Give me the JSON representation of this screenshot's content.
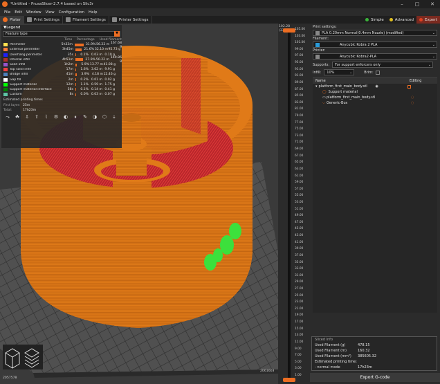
{
  "window": {
    "title": "*Untitled - PrusaSlicer-2.7.4 based on Slic3r"
  },
  "menu": [
    "File",
    "Edit",
    "Window",
    "View",
    "Configuration",
    "Help"
  ],
  "tabs": [
    {
      "label": "Plater",
      "active": true
    },
    {
      "label": "Print Settings",
      "active": false
    },
    {
      "label": "Filament Settings",
      "active": false
    },
    {
      "label": "Printer Settings",
      "active": false
    }
  ],
  "modes": [
    {
      "label": "Simple",
      "color": "#3bb43b"
    },
    {
      "label": "Advanced",
      "color": "#e0c020"
    },
    {
      "label": "Expert",
      "color": "#e04020"
    }
  ],
  "legend": {
    "title": "Legend",
    "view_type": "Feature type",
    "columns": [
      "",
      "Time",
      "Percentage",
      "Used filament"
    ],
    "rows": [
      {
        "name": "Perimeter",
        "color": "#ffe050",
        "time": "5h33m",
        "pct": "31.9%",
        "m": "56.22 m",
        "g": "167.68 g"
      },
      {
        "name": "External perimeter",
        "color": "#ff7d38",
        "time": "3h45m",
        "pct": "21.6%",
        "m": "32.10 m",
        "g": "95.73 g"
      },
      {
        "name": "Overhang perimeter",
        "color": "#1f1fff",
        "time": "35s",
        "pct": "0.1%",
        "m": "0.03 m",
        "g": "0.10 g"
      },
      {
        "name": "Internal infill",
        "color": "#b03029",
        "time": "4h51m",
        "pct": "27.9%",
        "m": "50.22 m",
        "g": "149.86 g"
      },
      {
        "name": "Solid infill",
        "color": "#9654cc",
        "time": "1h2m",
        "pct": "5.9%",
        "m": "13.77 m",
        "g": "41.08 g"
      },
      {
        "name": "Top solid infill",
        "color": "#f04040",
        "time": "17m",
        "pct": "1.6%",
        "m": "3.62 m",
        "g": "9.91 g"
      },
      {
        "name": "Bridge infill",
        "color": "#4d80ba",
        "time": "41m",
        "pct": "3.9%",
        "m": "4.18 m",
        "g": "12.46 g"
      },
      {
        "name": "Gap fill",
        "color": "#ffffff",
        "time": "2m",
        "pct": "0.2%",
        "m": "0.01 m",
        "g": "0.02 g"
      },
      {
        "name": "Support material",
        "color": "#00ff00",
        "time": "12m",
        "pct": "1.1%",
        "m": "0.59 m",
        "g": "1.75 g"
      },
      {
        "name": "Support material interface",
        "color": "#008000",
        "time": "58s",
        "pct": "0.1%",
        "m": "0.14 m",
        "g": "0.41 g"
      },
      {
        "name": "Custom",
        "color": "#5ec4a5",
        "time": "8s",
        "pct": "0.0%",
        "m": "0.03 m",
        "g": "0.07 g"
      }
    ],
    "est_title": "Estimated printing times",
    "first_layer_label": "First layer:",
    "first_layer": "25m",
    "total_label": "Total:",
    "total": "17h23m"
  },
  "viewport": {
    "top_left_value": "100.28 (331)",
    "bottom_left_value": "2057578",
    "bottom_right_value": "2061603"
  },
  "layer_ticks": [
    "105.00",
    "103.00",
    "101.00",
    "99.00",
    "97.00",
    "95.00",
    "93.00",
    "91.00",
    "89.00",
    "87.00",
    "85.00",
    "83.00",
    "81.00",
    "79.00",
    "77.00",
    "75.00",
    "73.00",
    "71.00",
    "69.00",
    "67.00",
    "65.00",
    "63.00",
    "61.00",
    "59.00",
    "57.00",
    "55.00",
    "53.00",
    "51.00",
    "49.00",
    "47.00",
    "45.00",
    "43.00",
    "41.00",
    "39.00",
    "37.00",
    "35.00",
    "33.00",
    "31.00",
    "29.00",
    "27.00",
    "25.00",
    "23.00",
    "21.00",
    "19.00",
    "17.00",
    "15.00",
    "13.00",
    "11.00",
    "9.00",
    "7.00",
    "5.00",
    "3.00",
    "1.00"
  ],
  "layer_top": "102.28",
  "layer_top_count": "(331)",
  "sidebar": {
    "print_settings_label": "Print settings:",
    "print_preset": "PLA 0.20mm Normal(0.4mm Nozzle)  (modified)",
    "filament_label": "Filament:",
    "filament_preset": "Anycubic Kobra 2 PLA",
    "filament_color": "#2a9ad8",
    "printer_label": "Printer:",
    "printer_preset": "Anycubic Kobra2-PLA",
    "supports_label": "Supports:",
    "supports_value": "For support enforcers only",
    "infill_label": "Infill:",
    "infill_value": "10%",
    "brim_label": "Brim:",
    "tree_header_name": "Name",
    "tree_header_editing": "Editing",
    "tree": [
      {
        "label": "platform_first_main_body.stl",
        "level": 0
      },
      {
        "label": "Support material",
        "level": 1
      },
      {
        "label": "platform_first_main_body.stl",
        "level": 1
      },
      {
        "label": "Generic-Box",
        "level": 1
      }
    ]
  },
  "sliced_info": {
    "title": "Sliced Info",
    "rows": [
      {
        "k": "Used Filament (g)",
        "v": "478.15"
      },
      {
        "k": "Used Filament (m)",
        "v": "160.32"
      },
      {
        "k": "Used Filament (mm³)",
        "v": "385605.32"
      }
    ],
    "est_label": "Estimated printing time:",
    "mode_label": "- normal mode",
    "mode_value": "17h23m"
  },
  "export_label": "Export G-code"
}
